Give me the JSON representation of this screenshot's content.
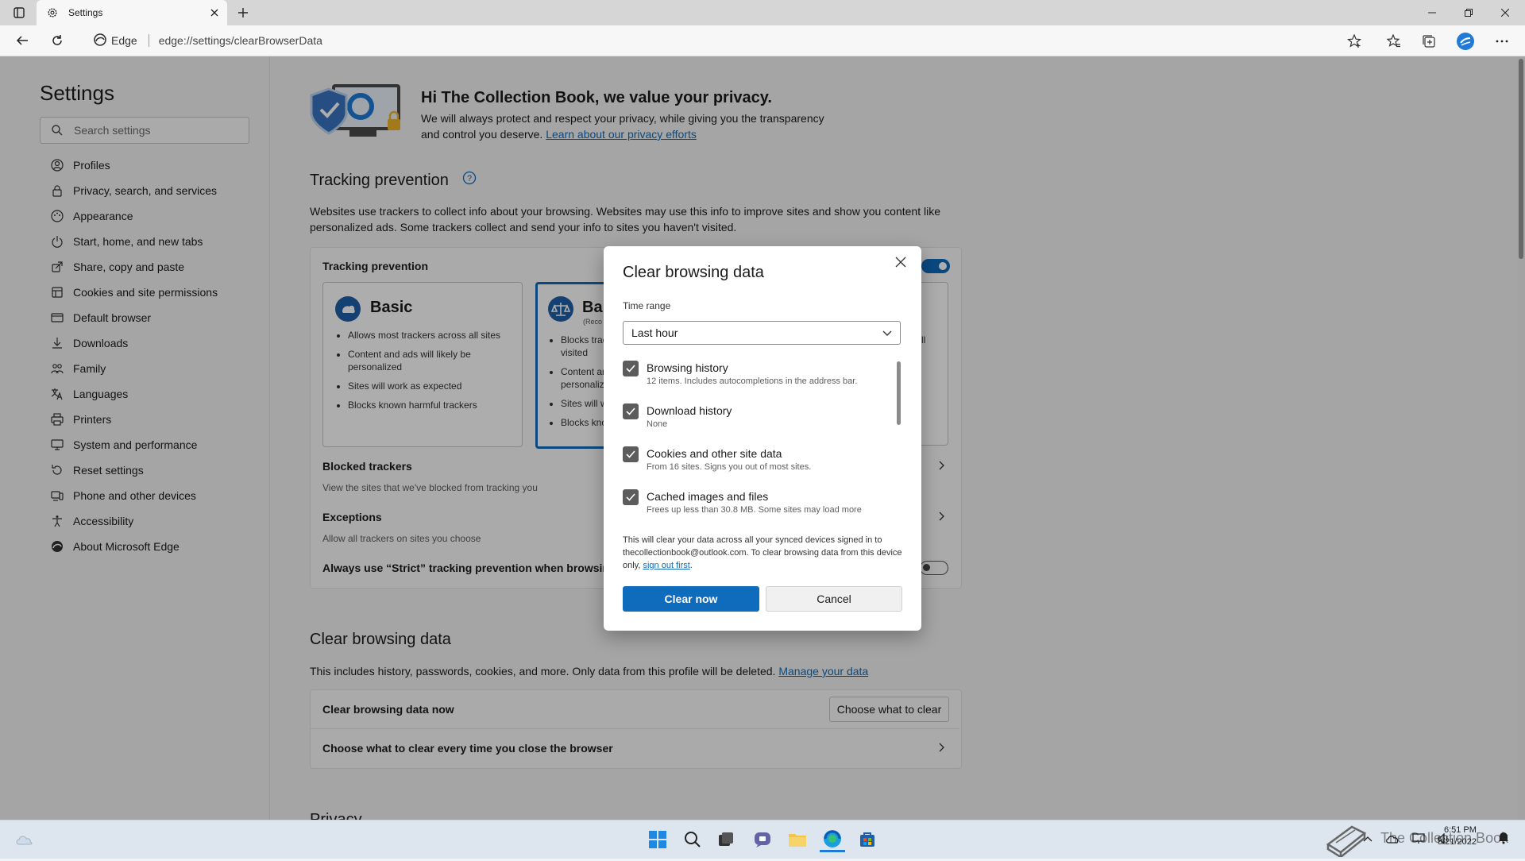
{
  "browser": {
    "tab_title": "Settings",
    "site_label": "Edge",
    "url": "edge://settings/clearBrowserData"
  },
  "sidebar": {
    "title": "Settings",
    "search_placeholder": "Search settings",
    "items": [
      {
        "label": "Profiles",
        "icon": "profile-icon"
      },
      {
        "label": "Privacy, search, and services",
        "icon": "lock-icon"
      },
      {
        "label": "Appearance",
        "icon": "appearance-icon"
      },
      {
        "label": "Start, home, and new tabs",
        "icon": "power-icon"
      },
      {
        "label": "Share, copy and paste",
        "icon": "share-icon"
      },
      {
        "label": "Cookies and site permissions",
        "icon": "cookies-icon"
      },
      {
        "label": "Default browser",
        "icon": "browser-icon"
      },
      {
        "label": "Downloads",
        "icon": "download-icon"
      },
      {
        "label": "Family",
        "icon": "family-icon"
      },
      {
        "label": "Languages",
        "icon": "languages-icon"
      },
      {
        "label": "Printers",
        "icon": "printer-icon"
      },
      {
        "label": "System and performance",
        "icon": "system-icon"
      },
      {
        "label": "Reset settings",
        "icon": "reset-icon"
      },
      {
        "label": "Phone and other devices",
        "icon": "phone-icon"
      },
      {
        "label": "Accessibility",
        "icon": "accessibility-icon"
      },
      {
        "label": "About Microsoft Edge",
        "icon": "edge-icon"
      }
    ]
  },
  "main": {
    "privacy_heading": "Hi The Collection Book, we value your privacy.",
    "privacy_line1": "We will always protect and respect your privacy, while giving you the transparency",
    "privacy_line2": "and control you deserve.",
    "privacy_link": "Learn about our privacy efforts",
    "tracking_title": "Tracking prevention",
    "tracking_desc1": "Websites use trackers to collect info about your browsing. Websites may use this info to improve sites and show you content like",
    "tracking_desc2": "personalized ads. Some trackers collect and send your info to sites you haven't visited.",
    "tracking_card_title": "Tracking prevention",
    "basic": {
      "title": "Basic",
      "bullets": [
        "Allows most trackers across all sites",
        "Content and ads will likely be",
        "personalized",
        "Sites will work as expected",
        "Blocks known harmful trackers"
      ]
    },
    "balanced": {
      "title": "Bal",
      "subtitle": "(Reco",
      "bullets": [
        "Blocks trac",
        "visited",
        "Content ar",
        "personaliz",
        "Sites will w",
        "Blocks kno"
      ]
    },
    "strict_fragment": "ll",
    "blocked_title": "Blocked trackers",
    "blocked_desc": "View the sites that we've blocked from tracking you",
    "exceptions_title": "Exceptions",
    "exceptions_desc": "Allow all trackers on sites you choose",
    "always_strict": "Always use “Strict” tracking prevention when browsing I",
    "clear_title": "Clear browsing data",
    "clear_desc": "This includes history, passwords, cookies, and more. Only data from this profile will be deleted.",
    "manage_link": "Manage your data",
    "clear_now_row": "Clear browsing data now",
    "choose_button": "Choose what to clear",
    "choose_every_time": "Choose what to clear every time you close the browser",
    "privacy_partial": "Privacy"
  },
  "dialog": {
    "title": "Clear browsing data",
    "time_range_label": "Time range",
    "time_range_value": "Last hour",
    "options": [
      {
        "label": "Browsing history",
        "desc": "12 items. Includes autocompletions in the address bar.",
        "checked": true
      },
      {
        "label": "Download history",
        "desc": "None",
        "checked": true
      },
      {
        "label": "Cookies and other site data",
        "desc": "From 16 sites. Signs you out of most sites.",
        "checked": true
      },
      {
        "label": "Cached images and files",
        "desc": "Frees up less than 30.8 MB. Some sites may load more",
        "checked": true
      }
    ],
    "sync_note": "This will clear your data across all your synced devices signed in to thecollectionbook@outlook.com. To clear browsing data from this device only,",
    "sign_out_link": "sign out first",
    "sync_note_end": ".",
    "clear_button": "Clear now",
    "cancel_button": "Cancel"
  },
  "taskbar": {
    "time": "6:51 PM",
    "date": "8/21/2022",
    "watermark": "The Collection Book"
  },
  "colors": {
    "accent": "#0f6cbd",
    "checkbox": "#5c5c5c"
  }
}
